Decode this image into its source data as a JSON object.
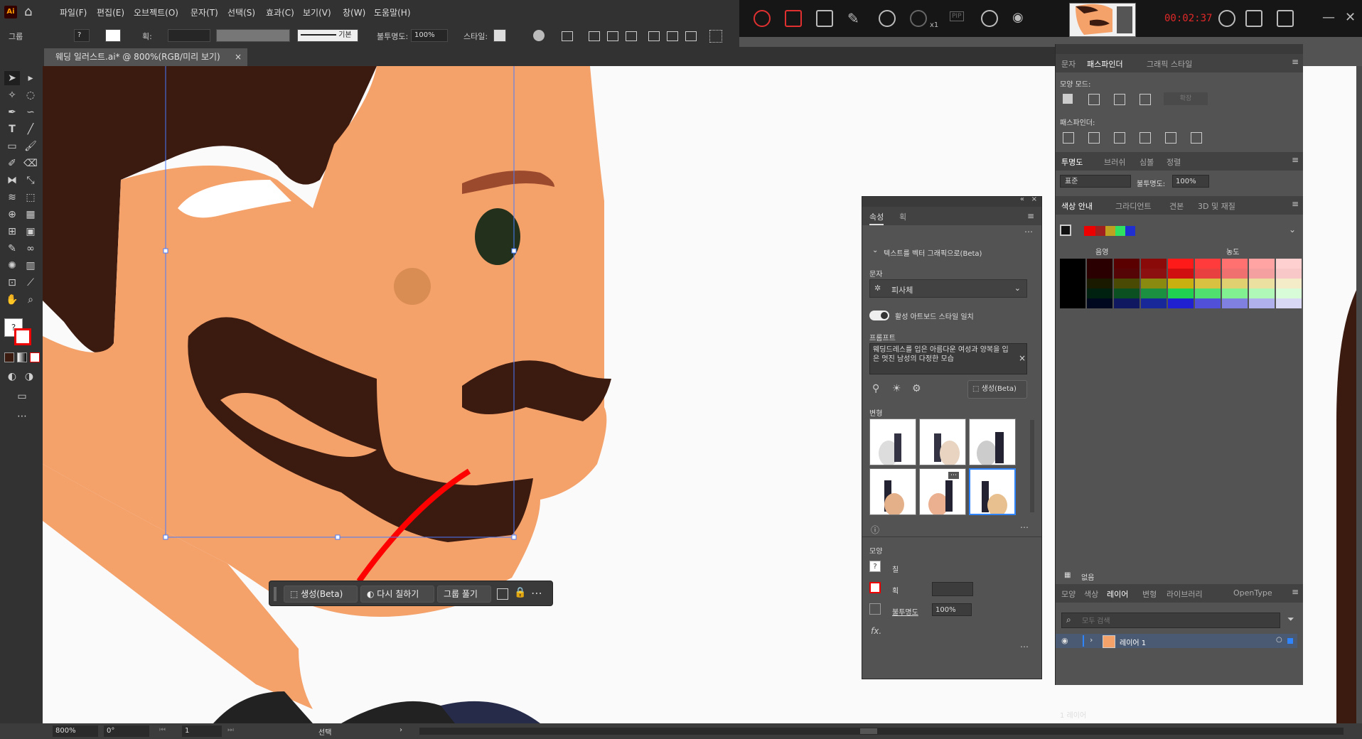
{
  "app": {
    "logo": "Ai",
    "menu": [
      "파일(F)",
      "편집(E)",
      "오브젝트(O)",
      "문자(T)",
      "선택(S)",
      "효과(C)",
      "보기(V)",
      "창(W)",
      "도움말(H)"
    ]
  },
  "recorder": {
    "time": "00:02:37",
    "zoom_label": "x1",
    "pip_label": "PIP"
  },
  "control_bar": {
    "selection_label": "그룹",
    "stroke_label": "획:",
    "stroke_style": "기본",
    "opacity_label": "불투명도:",
    "opacity_value": "100%",
    "style_label": "스타일:"
  },
  "document": {
    "tab_title": "웨딩 일러스트.ai* @ 800%(RGB/미리 보기)"
  },
  "context_bar": {
    "generate": "생성(Beta)",
    "recolor": "다시 칠하기",
    "ungroup": "그룹 풀기"
  },
  "properties": {
    "tabs": [
      "속성",
      "획"
    ],
    "section_title": "텍스트를 벡터 그래픽으로(Beta)",
    "subject_label": "문자",
    "subject_value": "피사체",
    "toggle_label": "활성 아트보드 스타일 일치",
    "prompt_label": "프롬프트",
    "prompt_text": "웨딩드레스를 입은 아름다운 여성과 양복을 입은 멋진 남성의 다정한 모습",
    "generate_button": "생성(Beta)",
    "variations_label": "변형",
    "appearance_label": "모양",
    "fill_label": "칠",
    "stroke_label": "획",
    "opacity_label": "불투명도",
    "opacity_value": "100%"
  },
  "right_panel": {
    "top_tabs": [
      "문자",
      "패스파인더",
      "그래픽 스타일"
    ],
    "shape_modes_label": "모양 모드:",
    "expand_label": "확장",
    "pathfinders_label": "패스파인더:",
    "trans_tabs": [
      "투명도",
      "브러쉬",
      "심볼",
      "정렬"
    ],
    "blend_mode": "표준",
    "opacity_label": "불투명도:",
    "opacity_value": "100%",
    "color_tabs": [
      "색상 안내",
      "그라디언트",
      "견본",
      "3D 및 재질"
    ],
    "shade_label": "음영",
    "saturation_label": "농도",
    "guide_footer": "없음",
    "layer_tabs": [
      "모양",
      "색상",
      "레이어",
      "변형",
      "라이브러리",
      "OpenType"
    ],
    "search_placeholder": "모두 검색",
    "layer_name": "레이어 1",
    "layer_count": "1 레이어"
  },
  "status": {
    "zoom": "800%",
    "angle": "0°",
    "page": "1",
    "mode": "선택"
  },
  "colors": {
    "accent": "#2f84ff",
    "skin": "#f4a16a",
    "hair": "#3b1a10",
    "stroke_red": "#ff0000",
    "eyebrow": "#9b4a2d",
    "pupil": "#22301c",
    "nose": "#d98d52",
    "guide_rows": [
      [
        "#000000",
        "#2b0000",
        "#5a0000",
        "#8a0a0a",
        "#ff1a1a",
        "#ff3b3b",
        "#ff7070",
        "#ffa3a3",
        "#ffd0d0"
      ],
      [
        "#000000",
        "#2a0000",
        "#550505",
        "#8c1010",
        "#d01010",
        "#e84040",
        "#f07070",
        "#f4a0a0",
        "#f8c8c8"
      ],
      [
        "#000000",
        "#1a1a00",
        "#4a4a05",
        "#8a8a10",
        "#c8b010",
        "#d8c040",
        "#e0d070",
        "#ece0a0",
        "#f4ecc8"
      ],
      [
        "#000000",
        "#002010",
        "#0a5020",
        "#1a9040",
        "#20d050",
        "#50e070",
        "#80f090",
        "#b0f8b8",
        "#d8fcd8"
      ],
      [
        "#000000",
        "#000820",
        "#101860",
        "#182898",
        "#2020d0",
        "#5050d8",
        "#8080e0",
        "#b0b0ec",
        "#d8d8f4"
      ]
    ]
  }
}
